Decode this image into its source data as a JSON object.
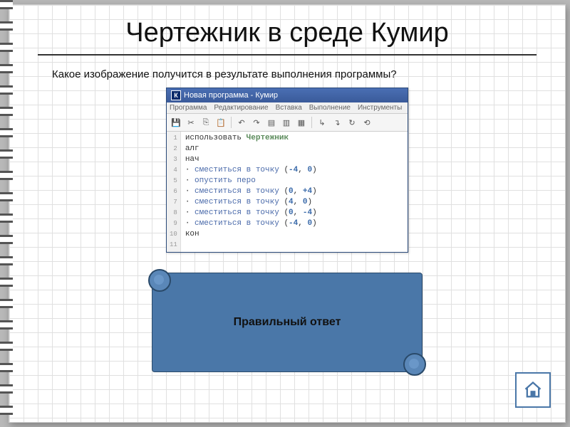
{
  "slide": {
    "title": "Чертежник в среде Кумир",
    "question": "Какое изображение получится в результате выполнения программы?"
  },
  "window": {
    "title": "Новая программа - Кумир",
    "icon_letter": "К",
    "menu": [
      "Программа",
      "Редактирование",
      "Вставка",
      "Выполнение",
      "Инструменты"
    ]
  },
  "toolbar_icons": [
    "save-icon",
    "cut-icon",
    "copy-icon",
    "paste-icon",
    "undo-icon",
    "redo-icon",
    "doc1-icon",
    "doc2-icon",
    "doc3-icon",
    "step-over-icon",
    "step-into-icon",
    "run-icon",
    "stop-icon"
  ],
  "code_lines": [
    {
      "n": "1",
      "html": "использовать <span class='kw'>Чертежник</span>"
    },
    {
      "n": "2",
      "html": "алг"
    },
    {
      "n": "3",
      "html": "нач"
    },
    {
      "n": "4",
      "html": "· <span class='cmd'>сместиться в точку</span> (<span class='neg'>-4</span>, <span class='num'>0</span>)"
    },
    {
      "n": "5",
      "html": "· <span class='cmd'>опустить перо</span>"
    },
    {
      "n": "6",
      "html": "· <span class='cmd'>сместиться в точку</span> (<span class='num'>0</span>, <span class='num'>+4</span>)"
    },
    {
      "n": "7",
      "html": "· <span class='cmd'>сместиться в точку</span> (<span class='num'>4</span>, <span class='num'>0</span>)"
    },
    {
      "n": "8",
      "html": "· <span class='cmd'>сместиться в точку</span> (<span class='num'>0</span>, <span class='neg'>-4</span>)"
    },
    {
      "n": "9",
      "html": "· <span class='cmd'>сместиться в точку</span> (<span class='neg'>-4</span>, <span class='num'>0</span>)"
    },
    {
      "n": "10",
      "html": "кон"
    },
    {
      "n": "11",
      "html": ""
    }
  ],
  "answer_box": {
    "label": "Правильный ответ"
  }
}
